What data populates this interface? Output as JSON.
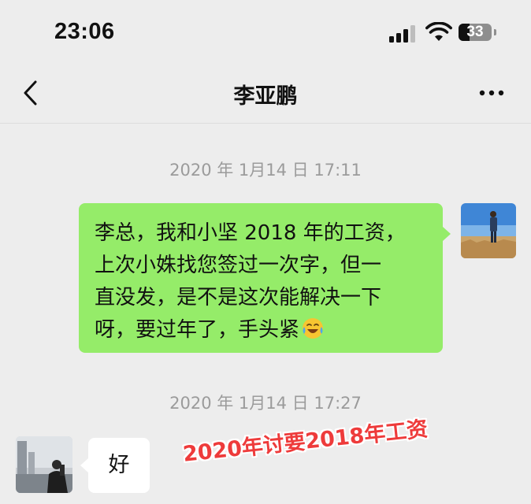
{
  "status_bar": {
    "time": "23:06",
    "battery": "33"
  },
  "nav": {
    "title": "李亚鹏",
    "back_icon": "chevron-left-icon",
    "more_icon": "more-dots-icon"
  },
  "messages": [
    {
      "timestamp": "2020 年 1月14 日 17:11",
      "sender": "self",
      "lines": [
        "李总，我和小坚 2018 年的工资，",
        "上次小姝找您签过一次字，但一",
        "直没发，是不是这次能解决一下",
        "呀，要过年了，手头紧"
      ],
      "trailing_emoji": "crying-laughing-emoji"
    },
    {
      "timestamp": "2020 年 1月14 日 17:27",
      "sender": "other",
      "text": "好"
    }
  ],
  "overlay": {
    "caption": "2020年讨要2018年工资"
  },
  "colors": {
    "background": "#ededed",
    "outgoing_bubble": "#95ec69",
    "incoming_bubble": "#ffffff",
    "timestamp": "#9b9b9b",
    "caption": "#ee3b3b"
  }
}
